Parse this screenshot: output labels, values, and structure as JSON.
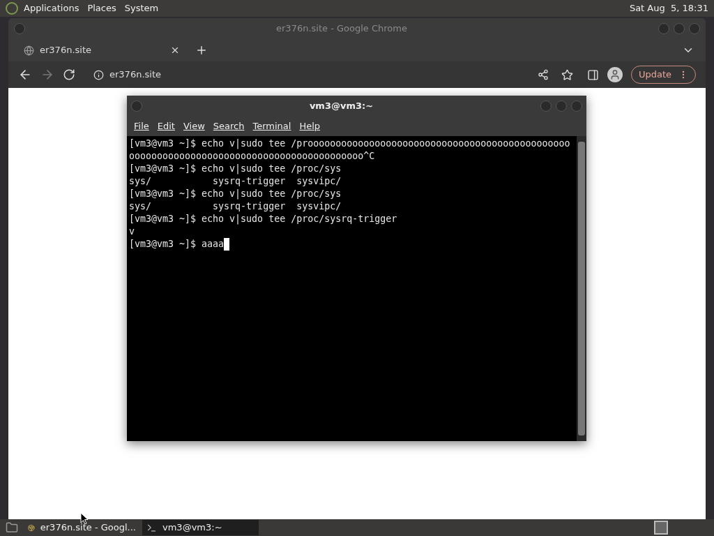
{
  "top_panel": {
    "menus": [
      "Applications",
      "Places",
      "System"
    ],
    "clock": "Sat Aug  5, 18:31"
  },
  "browser": {
    "title": "er376n.site - Google Chrome",
    "tabs": [
      {
        "label": "er376n.site",
        "selected": true
      }
    ],
    "address": "er376n.site",
    "update_button": "Update"
  },
  "terminal": {
    "title": "vm3@vm3:~",
    "menus": [
      "File",
      "Edit",
      "View",
      "Search",
      "Terminal",
      "Help"
    ],
    "lines": [
      "[vm3@vm3 ~]$ echo v|sudo tee /prooooooooooooooooooooooooooooooooooooooooooooooo",
      "oooooooooooooooooooooooooooooooooooooooooo^C",
      "[vm3@vm3 ~]$ echo v|sudo tee /proc/sys",
      "sys/           sysrq-trigger  sysvipc/",
      "[vm3@vm3 ~]$ echo v|sudo tee /proc/sys",
      "sys/           sysrq-trigger  sysvipc/",
      "[vm3@vm3 ~]$ echo v|sudo tee /proc/sysrq-trigger",
      "v"
    ],
    "input_line": {
      "text": "[vm3@vm3 ~]$ aaaa",
      "cursor": true
    }
  },
  "taskbar": {
    "tasks": [
      {
        "label": "er376n.site - Googl...",
        "kind": "browser",
        "selected": false
      },
      {
        "label": "vm3@vm3:~",
        "kind": "terminal",
        "selected": true
      }
    ]
  }
}
